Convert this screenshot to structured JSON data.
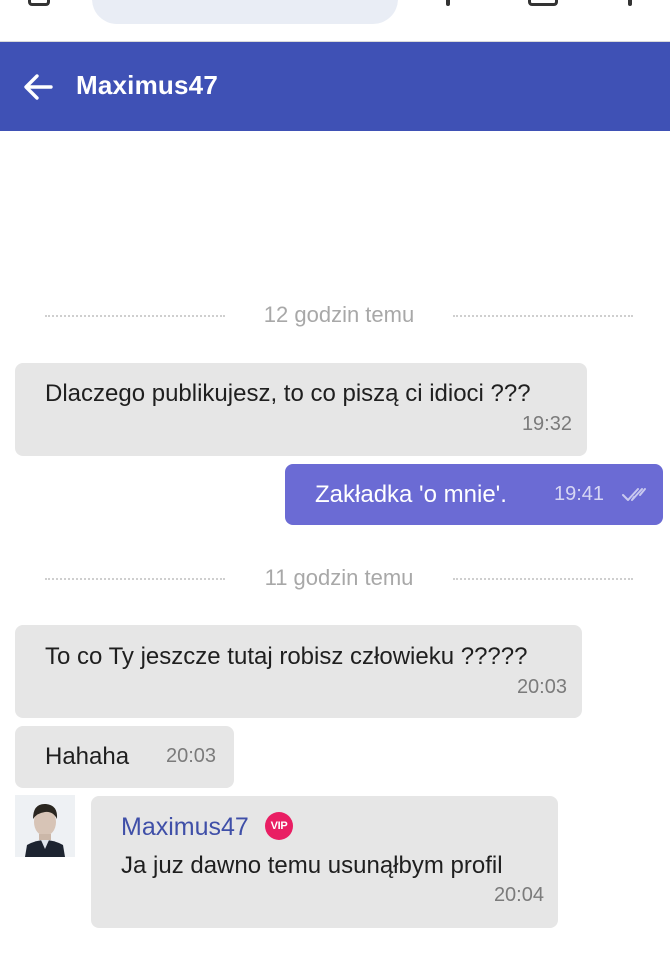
{
  "header": {
    "title": "Maximus47",
    "back_icon": "arrow-left-icon",
    "background": "#3f51b5"
  },
  "separators": [
    {
      "label": "12 godzin temu"
    },
    {
      "label": "11 godzin temu"
    }
  ],
  "messages": [
    {
      "direction": "in",
      "text": "Dlaczego publikujesz, to co piszą ci idioci ???",
      "time": "19:32"
    },
    {
      "direction": "out",
      "text": "Zakładka 'o mnie'.",
      "time": "19:41",
      "status_icon": "double-check-icon"
    },
    {
      "direction": "in",
      "text": "To co Ty jeszcze tutaj robisz człowieku ?????",
      "time": "20:03"
    },
    {
      "direction": "in",
      "text": "Hahaha",
      "time": "20:03"
    },
    {
      "direction": "in",
      "author": "Maximus47",
      "badge": "VIP",
      "text": "Ja juz dawno temu usunąłbym profil",
      "time": "20:04",
      "avatar_icon": "user-avatar"
    }
  ],
  "colors": {
    "accent": "#3f51b5",
    "outgoing_bubble": "#6b6bd4",
    "incoming_bubble": "#e6e6e6",
    "vip_badge": "#e91e63"
  }
}
